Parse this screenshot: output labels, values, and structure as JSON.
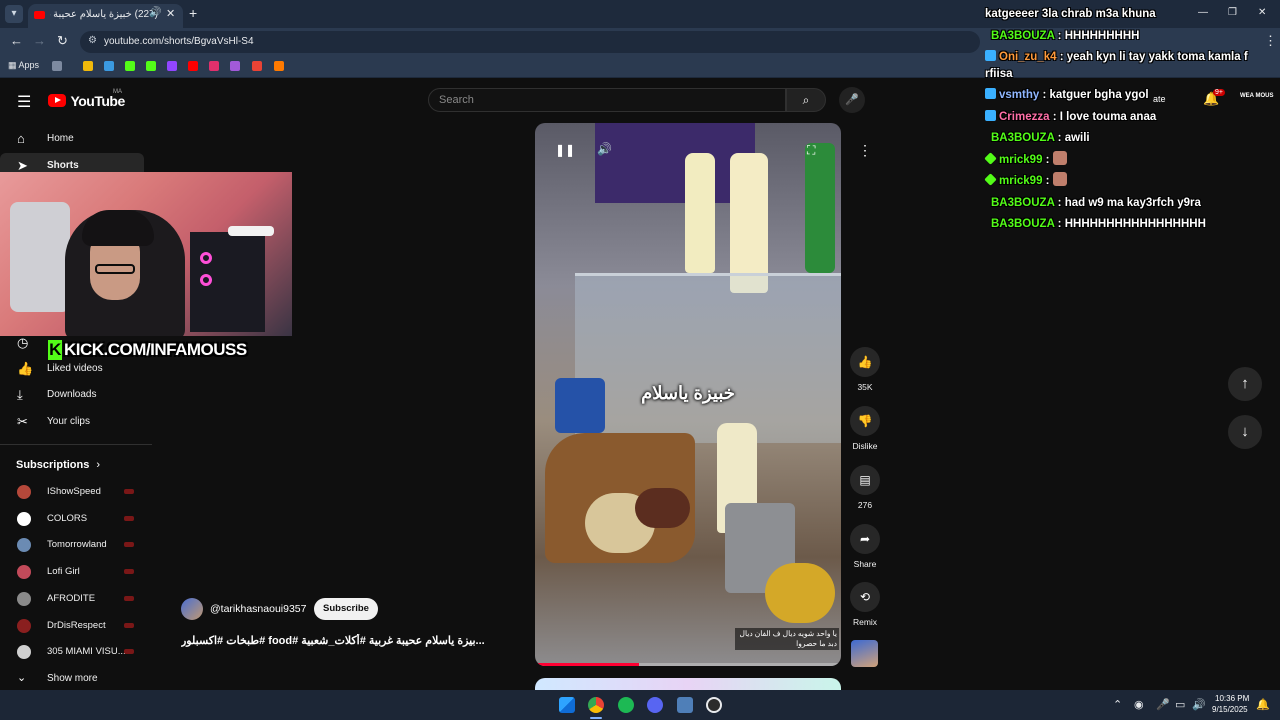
{
  "browser": {
    "tab_title": "(227) خبيزة ياسلام عحيبة غربي",
    "url": "youtube.com/shorts/BgvaVsHl-S4",
    "bookmarks_apps_label": "Apps"
  },
  "youtube": {
    "logo_text": "YouTube",
    "country_code": "MA",
    "search_placeholder": "Search",
    "create_label": "ate",
    "notifications_badge": "9+",
    "avatar_text": "WEA MOUS"
  },
  "sidebar": {
    "items": [
      {
        "label": "Home",
        "icon": "home-icon"
      },
      {
        "label": "Shorts",
        "icon": "shorts-icon"
      },
      {
        "label": "Liked videos",
        "icon": "thumbs-up-icon"
      },
      {
        "label": "Downloads",
        "icon": "download-icon"
      },
      {
        "label": "Your clips",
        "icon": "scissors-icon"
      }
    ],
    "subscriptions_header": "Subscriptions",
    "subscriptions": [
      {
        "label": "IShowSpeed",
        "color": "#b5483a"
      },
      {
        "label": "COLORS",
        "color": "#ffffff"
      },
      {
        "label": "Tomorrowland",
        "color": "#6b8bb3"
      },
      {
        "label": "Lofi Girl",
        "color": "#c24a5a"
      },
      {
        "label": "AFRODITE",
        "color": "#8a8a8a"
      },
      {
        "label": "DrDisRespect",
        "color": "#8a1f1f"
      },
      {
        "label": "305 MIAMI VISU...",
        "color": "#d0d0d0"
      }
    ],
    "show_more": "Show more"
  },
  "webcam": {
    "banner": "KICK.COM/INFAMOUSS",
    "banner_logo": "K"
  },
  "short": {
    "caption": "خبيزة ياسلام",
    "subtitle_line1": "يا واحد شويه ديال ف الفان ديال",
    "subtitle_line2": "دبد ما حصروا",
    "progress_fraction": 0.34,
    "channel_handle": "@tarikhasnaoui9357",
    "subscribe_label": "Subscribe",
    "title": "...بيزة ياسلام عحيبة غربية #أكلات_شعبية #food #طبخات #اكسبلور"
  },
  "actions": {
    "likes": "35K",
    "dislike": "Dislike",
    "comments": "276",
    "share": "Share",
    "remix": "Remix"
  },
  "chat": [
    {
      "user": "",
      "text": "katgeeeer 3la chrab m3a khuna",
      "partial": true
    },
    {
      "user": "BA3BOUZA",
      "text": "HHHHHHHHH",
      "color": "green"
    },
    {
      "user": "Oni_zu_k4",
      "text": "yeah kyn li tay yakk toma kamla f rfiisa",
      "color": "orange",
      "badge": "blue"
    },
    {
      "user": "vsmthy",
      "text": "katguer bgha ygol",
      "color": "blue",
      "badge": "blue"
    },
    {
      "user": "Crimezza",
      "text": "I love touma anaa",
      "color": "pink",
      "badge": "blue"
    },
    {
      "user": "BA3BOUZA",
      "text": "awili",
      "color": "green"
    },
    {
      "user": "mrick99",
      "text": "",
      "color": "green",
      "badge": "green",
      "emote": true
    },
    {
      "user": "mrick99",
      "text": "",
      "color": "green",
      "badge": "green",
      "emote": true
    },
    {
      "user": "BA3BOUZA",
      "text": "had w9 ma kay3rfch y9ra",
      "color": "green"
    },
    {
      "user": "BA3BOUZA",
      "text": "HHHHHHHHHHHHHHHHH",
      "color": "green"
    }
  ],
  "taskbar": {
    "time": "10:36 PM",
    "date": "9/15/2025"
  }
}
